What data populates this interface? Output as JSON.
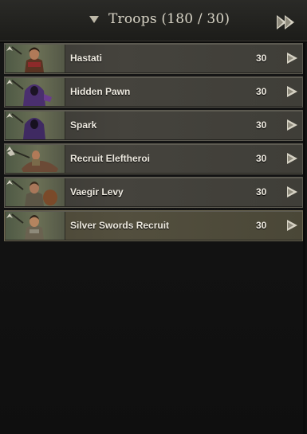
{
  "panel": {
    "title": "Troops (180 / 30)",
    "collapse_icon": "triangle-down-icon",
    "transfer_all_icon": "double-arrow-right-icon"
  },
  "troops": [
    {
      "name": "Hastati",
      "count": "30",
      "portrait_icon": "soldier-portrait-icon",
      "upgrade_icon": "chevron-up-icon",
      "transfer_icon": "arrow-right-icon"
    },
    {
      "name": "Hidden Pawn",
      "count": "30",
      "portrait_icon": "hooded-figure-portrait-icon",
      "upgrade_icon": "chevron-up-icon",
      "transfer_icon": "arrow-right-icon"
    },
    {
      "name": "Spark",
      "count": "30",
      "portrait_icon": "hooded-figure-portrait-icon",
      "upgrade_icon": "chevron-up-icon",
      "transfer_icon": "arrow-right-icon"
    },
    {
      "name": "Recruit Eleftheroi",
      "count": "30",
      "portrait_icon": "horseman-portrait-icon",
      "upgrade_icon": "chevron-up-icon",
      "transfer_icon": "arrow-right-icon"
    },
    {
      "name": "Vaegir Levy",
      "count": "30",
      "portrait_icon": "shield-bearer-portrait-icon",
      "upgrade_icon": "chevron-up-icon",
      "transfer_icon": "arrow-right-icon"
    },
    {
      "name": "Silver Swords Recruit",
      "count": "30",
      "portrait_icon": "soldier-portrait-icon",
      "upgrade_icon": "chevron-up-icon",
      "transfer_icon": "arrow-right-icon"
    }
  ],
  "colors": {
    "background": "#121212",
    "row": "#423f39",
    "row_highlight": "#524e3d",
    "text": "#eeeae0",
    "hood_purple": "#4a2f6e"
  }
}
